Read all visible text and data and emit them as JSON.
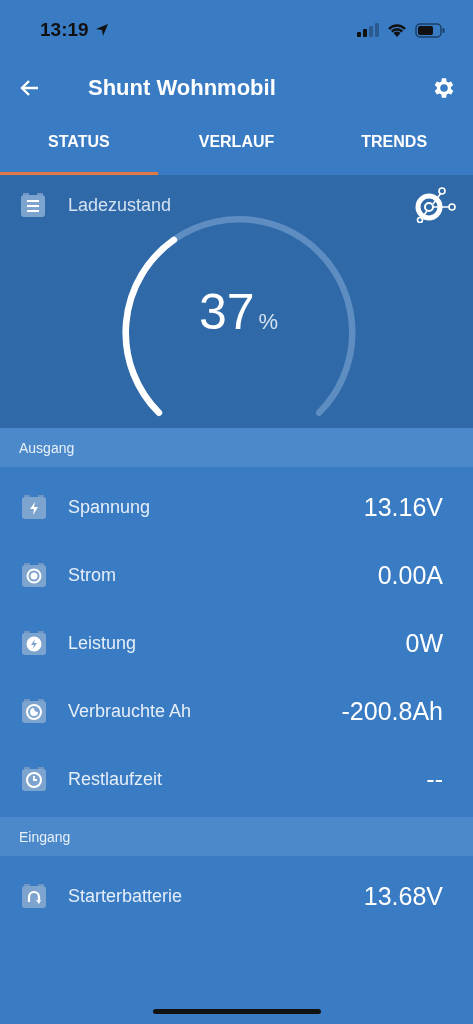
{
  "status_bar": {
    "time": "13:19"
  },
  "header": {
    "title": "Shunt Wohnmobil"
  },
  "tabs": [
    {
      "label": "STATUS",
      "selected": true
    },
    {
      "label": "VERLAUF",
      "selected": false
    },
    {
      "label": "TRENDS",
      "selected": false
    }
  ],
  "gauge": {
    "label": "Ladezustand",
    "value": "37",
    "unit": "%"
  },
  "sections": [
    {
      "title": "Ausgang",
      "rows": [
        {
          "kind": "bolt",
          "label": "Spannung",
          "value": "13.16V"
        },
        {
          "kind": "dot",
          "label": "Strom",
          "value": "0.00A"
        },
        {
          "kind": "power",
          "label": "Leistung",
          "value": "0W"
        },
        {
          "kind": "moon",
          "label": "Verbrauchte Ah",
          "value": "-200.8Ah"
        },
        {
          "kind": "clock",
          "label": "Restlaufzeit",
          "value": "--"
        }
      ]
    },
    {
      "title": "Eingang",
      "rows": [
        {
          "kind": "cycle",
          "label": "Starterbatterie",
          "value": "13.68V"
        }
      ]
    }
  ]
}
